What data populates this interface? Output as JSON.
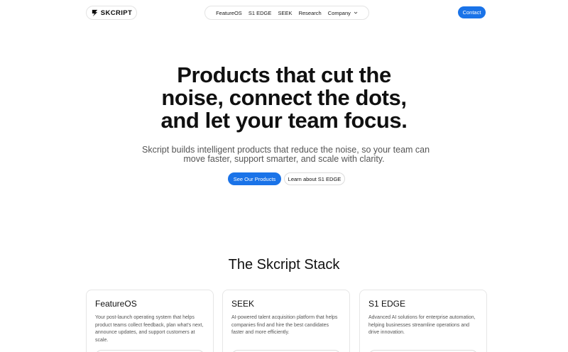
{
  "header": {
    "logo_text": "SKCRIPT",
    "nav": [
      "FeatureOS",
      "S1 EDGE",
      "SEEK",
      "Research",
      "Company"
    ],
    "contact_label": "Contact"
  },
  "hero": {
    "title_lines": [
      "Products that cut the",
      "noise, connect the dots,",
      "and let your team focus."
    ],
    "subtitle_lines": [
      "Skcript builds intelligent products that reduce the noise, so your team can",
      "move faster, support smarter, and scale with clarity."
    ],
    "primary_cta": "See Our Products",
    "secondary_cta": "Learn about S1 EDGE"
  },
  "stack": {
    "title": "The Skcript Stack",
    "cards": [
      {
        "title": "FeatureOS",
        "description": "Your post-launch operating system that helps product teams collect feedback, plan what's next, announce updates, and support customers at scale."
      },
      {
        "title": "SEEK",
        "description": "AI-powered talent acquisition platform that helps companies find and hire the best candidates faster and more efficiently."
      },
      {
        "title": "S1 EDGE",
        "description": "Advanced AI solutions for enterprise automation, helping businesses streamline operations and drive innovation."
      }
    ]
  },
  "colors": {
    "accent": "#1a73e8",
    "text": "#111111",
    "muted": "#555555",
    "border": "#e3e3e3"
  }
}
